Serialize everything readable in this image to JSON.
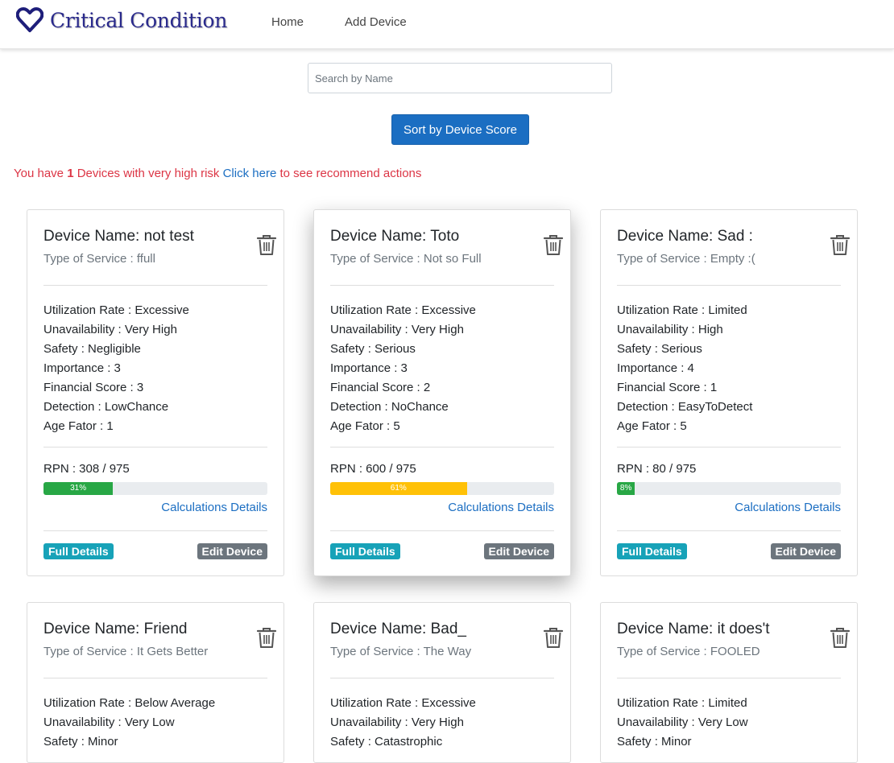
{
  "app": {
    "brand": "Critical Condition"
  },
  "nav": {
    "home": "Home",
    "add_device": "Add Device"
  },
  "search": {
    "placeholder": "Search by Name",
    "value": ""
  },
  "sort_button": "Sort by Device Score",
  "alert": {
    "prefix": "You have",
    "count": "1",
    "middle": "Devices with very high risk",
    "click": "Click",
    "here": "here",
    "suffix": "to see recommend actions"
  },
  "colors": {
    "accent": "#1b6ec2",
    "danger": "#dc3545",
    "bar_green": "#28a745",
    "bar_yellow": "#ffc107",
    "info": "#17a2b8",
    "secondary": "#6c757d"
  },
  "buttons": {
    "full_details": "Full Details",
    "edit_device": "Edit Device",
    "calc_details": "Calculations Details"
  },
  "cards": [
    {
      "name": "Device Name: not test",
      "service": "Type of Service : ffull",
      "props": [
        "Utilization Rate : Excessive",
        "Unavailability : Very High",
        "Safety : Negligible",
        "Importance : 3",
        "Financial Score : 3",
        "Detection : LowChance",
        "Age Fator : 1"
      ],
      "rpn": "RPN : 308 / 975",
      "percent_label": "31%",
      "percent": 31,
      "bar_color": "#28a745"
    },
    {
      "name": "Device Name: Toto",
      "service": "Type of Service : Not so Full",
      "props": [
        "Utilization Rate : Excessive",
        "Unavailability : Very High",
        "Safety : Serious",
        "Importance : 3",
        "Financial Score : 2",
        "Detection : NoChance",
        "Age Fator : 5"
      ],
      "rpn": "RPN : 600 / 975",
      "percent_label": "61%",
      "percent": 61,
      "bar_color": "#ffc107"
    },
    {
      "name": "Device Name: Sad :",
      "service": "Type of Service : Empty :(",
      "props": [
        "Utilization Rate : Limited",
        "Unavailability : High",
        "Safety : Serious",
        "Importance : 4",
        "Financial Score : 1",
        "Detection : EasyToDetect",
        "Age Fator : 5"
      ],
      "rpn": "RPN : 80 / 975",
      "percent_label": "8%",
      "percent": 8,
      "bar_color": "#28a745"
    },
    {
      "name": "Device Name: Friend",
      "service": "Type of Service : It Gets Better",
      "props": [
        "Utilization Rate : Below Average",
        "Unavailability : Very Low",
        "Safety : Minor"
      ]
    },
    {
      "name": "Device Name: Bad_",
      "service": "Type of Service : The Way",
      "props": [
        "Utilization Rate : Excessive",
        "Unavailability : Very High",
        "Safety : Catastrophic"
      ]
    },
    {
      "name": "Device Name: it does't",
      "service": "Type of Service : FOOLED",
      "props": [
        "Utilization Rate : Limited",
        "Unavailability : Very Low",
        "Safety : Minor"
      ]
    }
  ]
}
